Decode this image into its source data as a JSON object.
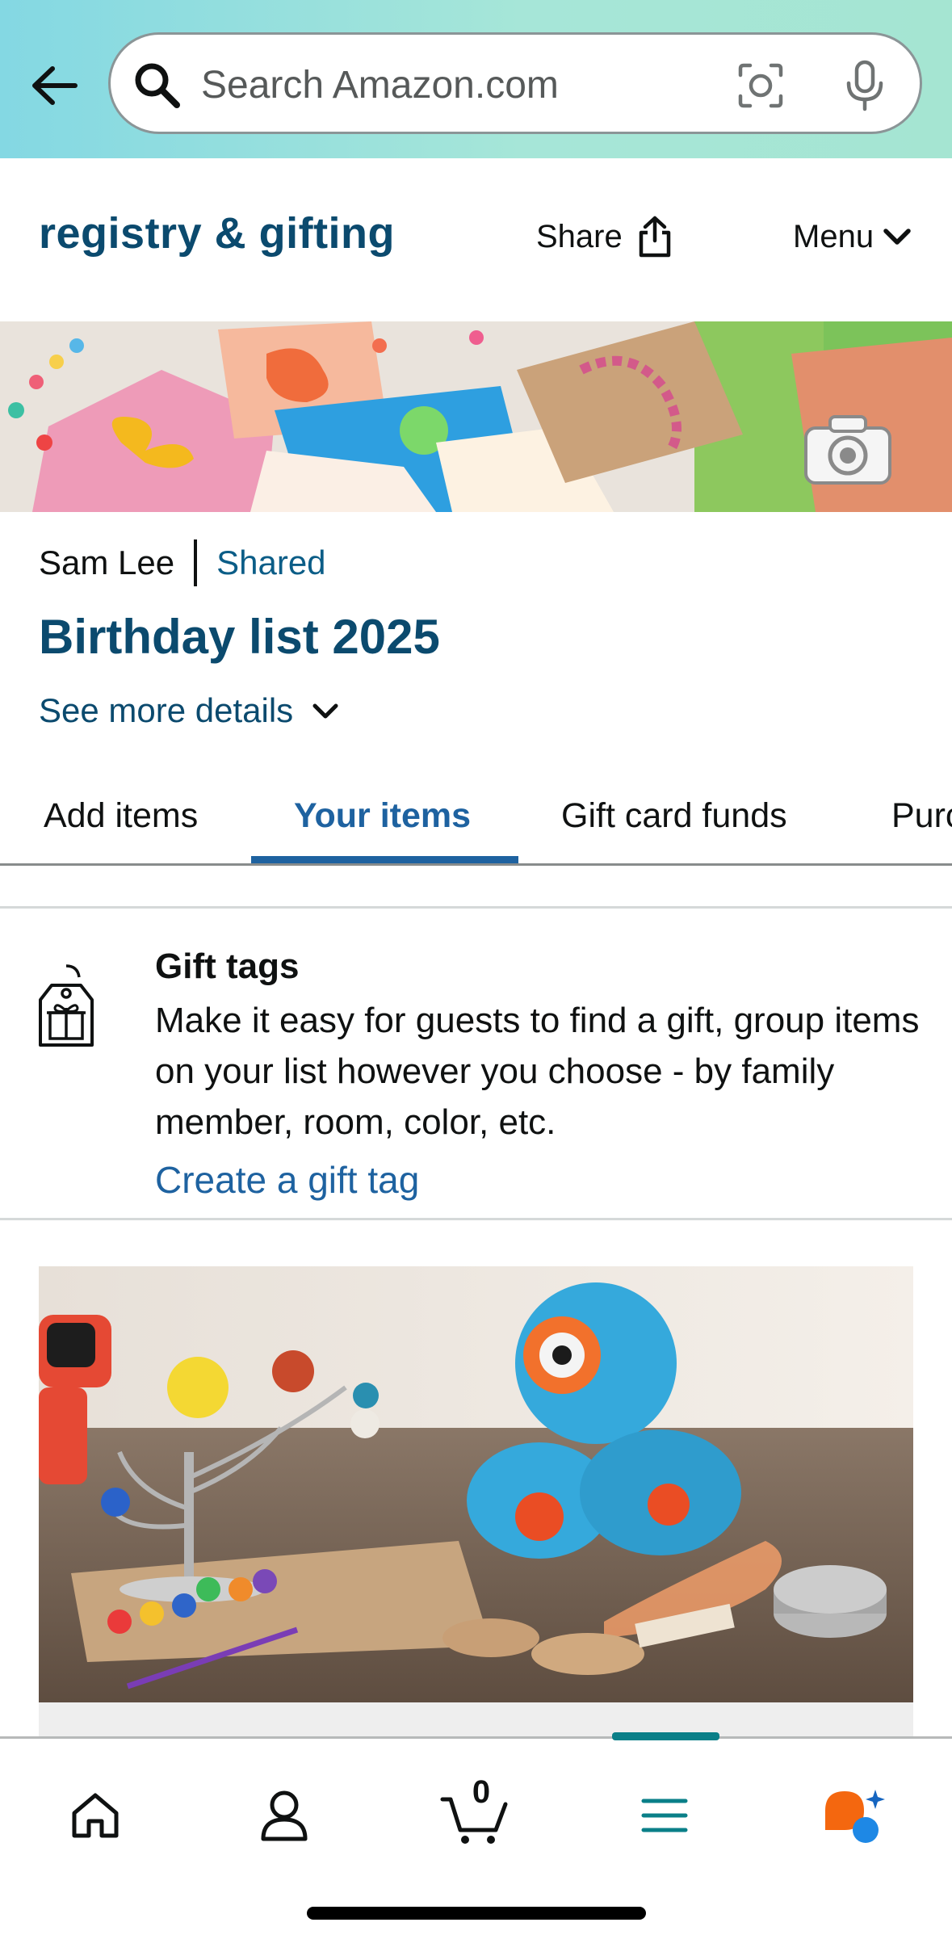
{
  "search": {
    "placeholder": "Search Amazon.com"
  },
  "registry": {
    "title": "registry & gifting",
    "share_label": "Share",
    "menu_label": "Menu"
  },
  "list": {
    "owner": "Sam Lee",
    "status": "Shared",
    "title": "Birthday list 2025",
    "details_link": "See more details"
  },
  "tabs": [
    {
      "label": "Add items"
    },
    {
      "label": "Your items",
      "active": true
    },
    {
      "label": "Gift card funds"
    },
    {
      "label": "Purc"
    }
  ],
  "gift_tags": {
    "heading": "Gift tags",
    "description": "Make it easy for guests to find a gift, group items on your list however you choose - by family member, room, color, etc.",
    "link": "Create a gift tag"
  },
  "cart": {
    "count": "0"
  },
  "colors": {
    "accent_blue": "#1e62a0",
    "title_navy": "#0b4a6e",
    "nav_active": "#0a7f88",
    "header_gradient_start": "#84d8e3",
    "header_gradient_end": "#a5e5d2"
  },
  "icons": {
    "back": "arrow-left-icon",
    "search": "search-icon",
    "lens": "camera-lens-icon",
    "mic": "microphone-icon",
    "share": "share-icon",
    "menu": "chevron-down-icon",
    "banner_camera": "camera-icon",
    "gift_tag": "gift-tag-icon",
    "home": "home-icon",
    "account": "account-icon",
    "cart": "cart-icon",
    "menu_nav": "hamburger-icon",
    "rufus": "rufus-ai-icon"
  }
}
